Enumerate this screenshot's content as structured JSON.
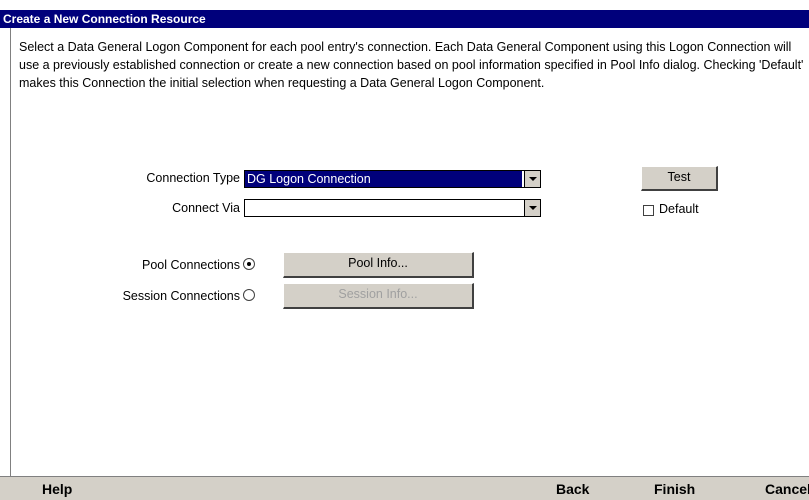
{
  "window": {
    "title": "Create a New Connection Resource"
  },
  "description": "Select a Data General Logon Component for each pool entry's connection. Each Data General Component using this Logon Connection will use a previously established connection or create a new connection based on pool information specified in Pool Info dialog. Checking 'Default' makes this Connection the initial selection when requesting a Data General Logon Component.",
  "form": {
    "connection_type": {
      "label": "Connection Type",
      "value": "DG Logon Connection"
    },
    "connect_via": {
      "label": "Connect Via",
      "value": ""
    },
    "test_button": "Test",
    "default_checkbox": {
      "label": "Default",
      "checked": false
    },
    "pool_connections": {
      "label": "Pool Connections",
      "selected": true
    },
    "session_connections": {
      "label": "Session Connections",
      "selected": false
    },
    "pool_info_button": "Pool Info...",
    "session_info_button": "Session Info..."
  },
  "footer": {
    "help": "Help",
    "back": "Back",
    "finish": "Finish",
    "cancel": "Cancel"
  },
  "colors": {
    "title_bar": "#00007b",
    "button_face": "#d4d0c8",
    "selection": "#00007b"
  }
}
